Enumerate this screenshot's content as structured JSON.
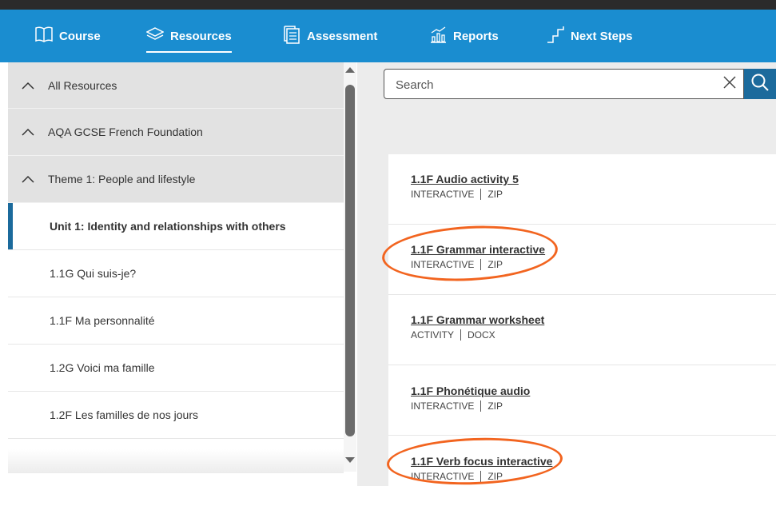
{
  "nav": {
    "items": [
      {
        "label": "Course",
        "icon": "book-icon"
      },
      {
        "label": "Resources",
        "icon": "layers-icon",
        "active": true
      },
      {
        "label": "Assessment",
        "icon": "checklist-icon"
      },
      {
        "label": "Reports",
        "icon": "bar-chart-icon"
      },
      {
        "label": "Next Steps",
        "icon": "steps-icon"
      }
    ]
  },
  "sidebar": {
    "items": [
      {
        "label": "All Resources",
        "expanded": true
      },
      {
        "label": "AQA GCSE French Foundation",
        "expanded": true
      },
      {
        "label": "Theme 1: People and lifestyle",
        "expanded": true
      },
      {
        "label": "Unit 1: Identity and relationships with others",
        "active": true
      },
      {
        "label": "1.1G Qui suis-je?"
      },
      {
        "label": "1.1F Ma personnalité"
      },
      {
        "label": "1.2G Voici ma famille"
      },
      {
        "label": "1.2F Les familles de nos jours"
      }
    ]
  },
  "search": {
    "placeholder": "Search",
    "value": ""
  },
  "resources": [
    {
      "title": "1.1F Audio activity 5",
      "type": "INTERACTIVE",
      "format": "ZIP"
    },
    {
      "title": "1.1F Grammar interactive",
      "type": "INTERACTIVE",
      "format": "ZIP",
      "circled": true
    },
    {
      "title": "1.1F Grammar worksheet",
      "type": "ACTIVITY",
      "format": "DOCX"
    },
    {
      "title": "1.1F Phonétique audio",
      "type": "INTERACTIVE",
      "format": "ZIP"
    },
    {
      "title": "1.1F Verb focus interactive",
      "type": "INTERACTIVE",
      "format": "ZIP",
      "circled": true
    }
  ],
  "colors": {
    "nav_bg": "#1a8dd0",
    "active_bar": "#1b6a9c",
    "search_button": "#1b6a9c",
    "annotation": "#f2641f"
  }
}
